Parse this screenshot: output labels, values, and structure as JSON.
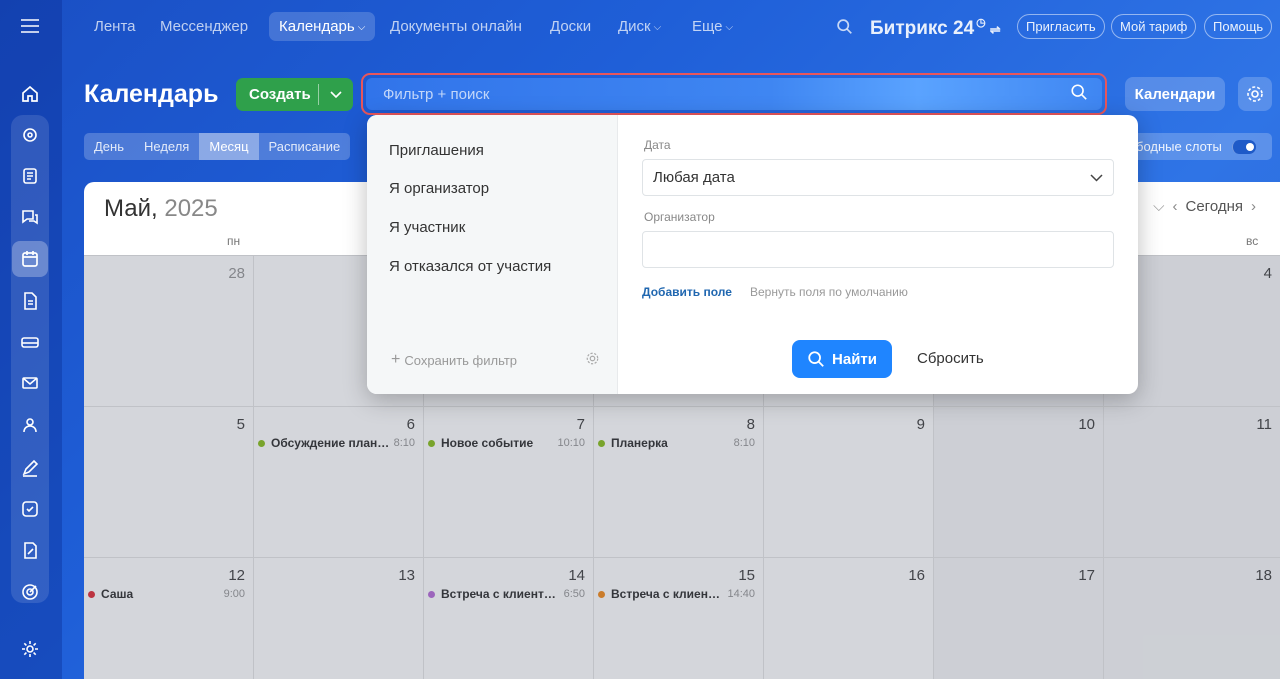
{
  "nav": {
    "items": [
      "Лента",
      "Мессенджер",
      "Календарь",
      "Документы онлайн",
      "Доски",
      "Диск",
      "Еще"
    ],
    "brand": "Битрикс 24",
    "invite": "Пригласить",
    "tariff": "Мой тариф",
    "help": "Помощь"
  },
  "header": {
    "title": "Календарь",
    "create_label": "Создать",
    "search_placeholder": "Фильтр + поиск",
    "calendars_label": "Календари"
  },
  "view_tabs": [
    "День",
    "Неделя",
    "Месяц",
    "Расписание"
  ],
  "active_view": "Месяц",
  "slots_label": "бодные слоты",
  "calendar": {
    "month": "Май,",
    "year": "2025",
    "today_label": "Сегодня",
    "dow_first": "пн",
    "dow_last": "вс",
    "weeks": [
      [
        {
          "d": "28",
          "muted": true
        },
        {
          "d": ""
        },
        {
          "d": ""
        },
        {
          "d": ""
        },
        {
          "d": ""
        },
        {
          "d": ""
        },
        {
          "d": "4"
        }
      ],
      [
        {
          "d": "5"
        },
        {
          "d": "6",
          "ev": "Обсуждение план…",
          "tm": "8:10",
          "c": "#8bbf1f"
        },
        {
          "d": "7",
          "ev": "Новое событие",
          "tm": "10:10",
          "c": "#8bbf1f"
        },
        {
          "d": "8",
          "ev": "Планерка",
          "tm": "8:10",
          "c": "#8bbf1f"
        },
        {
          "d": "9"
        },
        {
          "d": "10"
        },
        {
          "d": "11"
        }
      ],
      [
        {
          "d": "12",
          "ev": "Саша",
          "tm": "9:00",
          "c": "#e0303a"
        },
        {
          "d": "13"
        },
        {
          "d": "14",
          "ev": "Встреча с клиент…",
          "tm": "6:50",
          "c": "#b86fd8"
        },
        {
          "d": "15",
          "ev": "Встреча с клиен…",
          "tm": "14:40",
          "c": "#f28c1e"
        },
        {
          "d": "16"
        },
        {
          "d": "17"
        },
        {
          "d": "18"
        }
      ]
    ]
  },
  "filter": {
    "presets": [
      "Приглашения",
      "Я организатор",
      "Я участник",
      "Я отказался от участия"
    ],
    "save_filter": "Сохранить фильтр",
    "date_label": "Дата",
    "date_value": "Любая дата",
    "organizer_label": "Организатор",
    "organizer_value": "",
    "add_field": "Добавить поле",
    "reset_fields": "Вернуть поля по умолчанию",
    "find": "Найти",
    "reset": "Сбросить"
  }
}
